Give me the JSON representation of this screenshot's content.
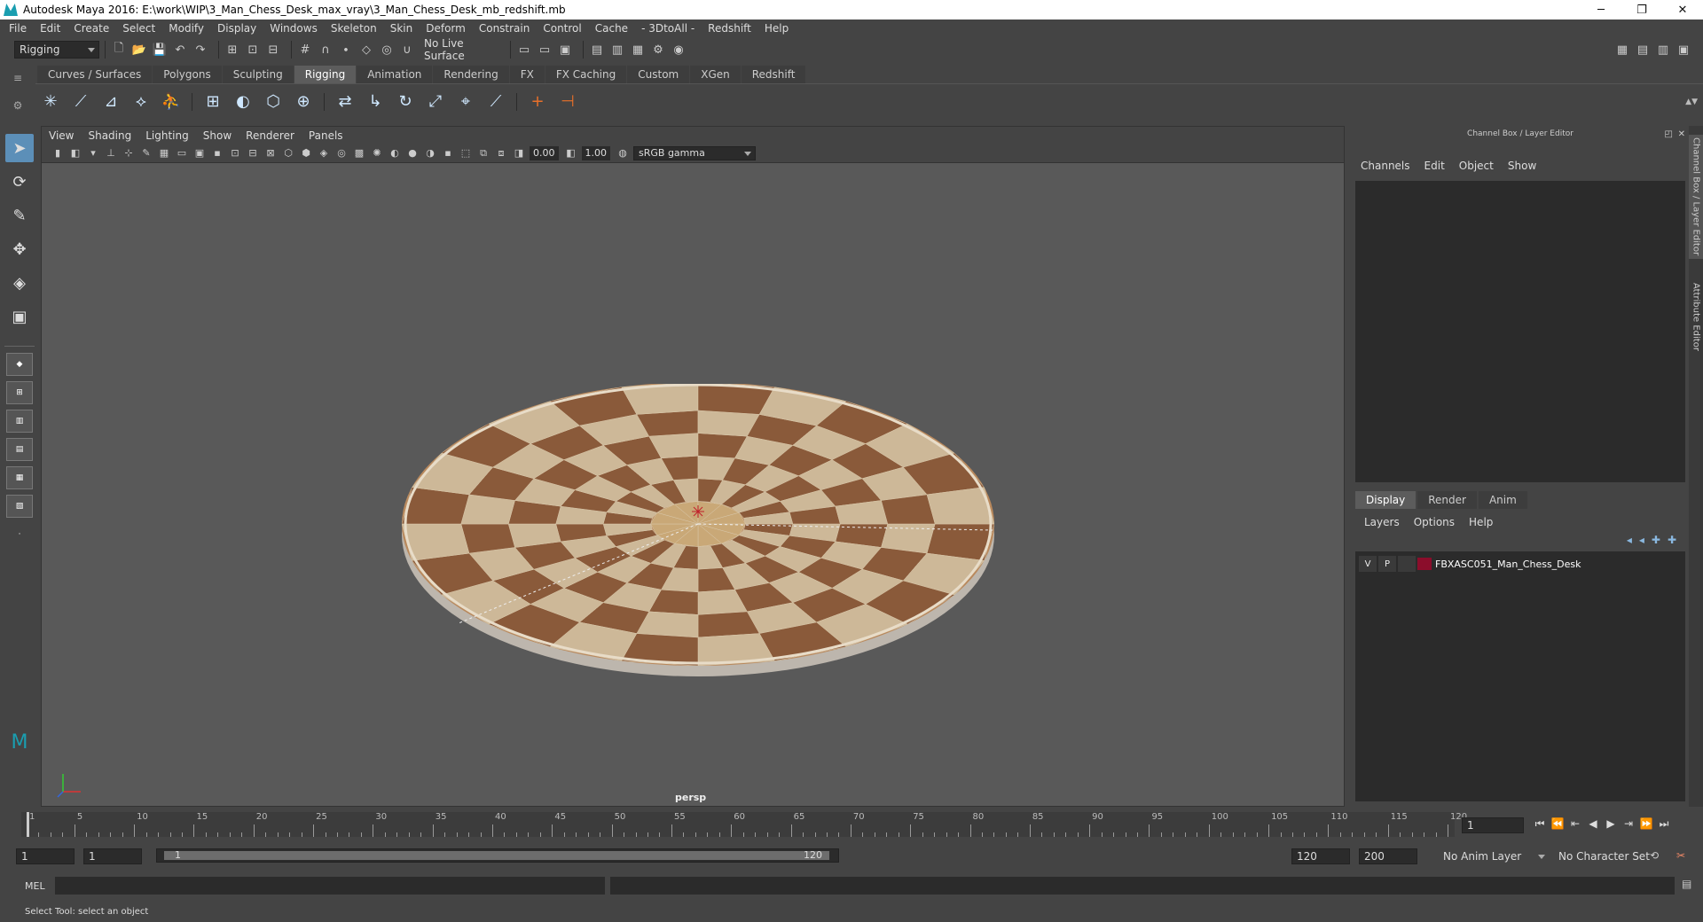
{
  "window": {
    "title": "Autodesk Maya 2016: E:\\work\\WIP\\3_Man_Chess_Desk_max_vray\\3_Man_Chess_Desk_mb_redshift.mb",
    "minimize": "─",
    "restore": "❐",
    "close": "✕"
  },
  "menu": [
    "File",
    "Edit",
    "Create",
    "Select",
    "Modify",
    "Display",
    "Windows",
    "Skeleton",
    "Skin",
    "Deform",
    "Constrain",
    "Control",
    "Cache",
    "- 3DtoAll -",
    "Redshift",
    "Help"
  ],
  "status": {
    "mode": "Rigging",
    "live_surface": "No Live Surface"
  },
  "shelf_tabs": [
    "Curves / Surfaces",
    "Polygons",
    "Sculpting",
    "Rigging",
    "Animation",
    "Rendering",
    "FX",
    "FX Caching",
    "Custom",
    "XGen",
    "Redshift"
  ],
  "active_shelf_tab": "Rigging",
  "viewport": {
    "menu": [
      "View",
      "Shading",
      "Lighting",
      "Show",
      "Renderer",
      "Panels"
    ],
    "exposure": "0.00",
    "gamma": "1.00",
    "color_space": "sRGB gamma",
    "camera_label": "persp"
  },
  "channel_box": {
    "title": "Channel Box / Layer Editor",
    "menu": [
      "Channels",
      "Edit",
      "Object",
      "Show"
    ]
  },
  "layer_editor": {
    "tabs": [
      "Display",
      "Render",
      "Anim"
    ],
    "active_tab": "Display",
    "menu": [
      "Layers",
      "Options",
      "Help"
    ],
    "layer": {
      "v": "V",
      "p": "P",
      "name": "FBXASC051_Man_Chess_Desk",
      "color": "#8b0d2b"
    }
  },
  "side_tabs": [
    "Channel Box / Layer Editor",
    "Attribute Editor"
  ],
  "timeline": {
    "ticks": [
      "1",
      "5",
      "10",
      "15",
      "20",
      "25",
      "30",
      "35",
      "40",
      "45",
      "50",
      "55",
      "60",
      "65",
      "70",
      "75",
      "80",
      "85",
      "90",
      "95",
      "100",
      "105",
      "110",
      "115",
      "120"
    ],
    "current_frame": "1"
  },
  "range": {
    "start": "1",
    "playback_start": "1",
    "slider_start": "1",
    "slider_end": "120",
    "playback_end": "120",
    "end": "200",
    "anim_layer": "No Anim Layer",
    "character_set": "No Character Set"
  },
  "command_line": {
    "label": "MEL"
  },
  "help_line": "Select Tool: select an object",
  "colors": {
    "ui_bg": "#444444",
    "viewport_bg": "#595959",
    "tile_dark": "#8a5a3a",
    "tile_light": "#cdb898"
  }
}
